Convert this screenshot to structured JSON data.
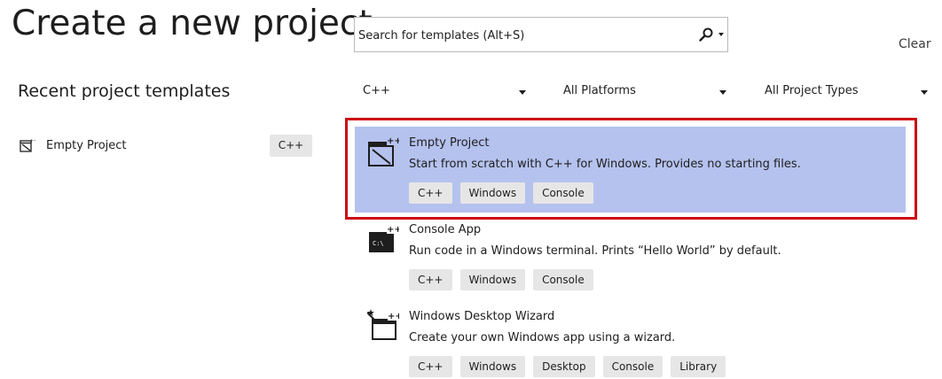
{
  "page": {
    "title": "Create a new project",
    "clear_label": "Clear"
  },
  "search": {
    "placeholder": "Search for templates (Alt+S)",
    "icon": "search-icon"
  },
  "recent": {
    "heading": "Recent project templates",
    "items": [
      {
        "label": "Empty Project",
        "tag": "C++",
        "icon": "empty-project-icon"
      }
    ]
  },
  "filters": {
    "language": "C++",
    "platform": "All Platforms",
    "project_type": "All Project Types"
  },
  "templates": [
    {
      "title": "Empty Project",
      "description": "Start from scratch with C++ for Windows. Provides no starting files.",
      "tags": [
        "C++",
        "Windows",
        "Console"
      ],
      "icon": "empty-project-icon",
      "selected": true
    },
    {
      "title": "Console App",
      "description": "Run code in a Windows terminal. Prints “Hello World” by default.",
      "tags": [
        "C++",
        "Windows",
        "Console"
      ],
      "icon": "console-app-icon",
      "selected": false
    },
    {
      "title": "Windows Desktop Wizard",
      "description": "Create your own Windows app using a wizard.",
      "tags": [
        "C++",
        "Windows",
        "Desktop",
        "Console",
        "Library"
      ],
      "icon": "desktop-wizard-icon",
      "selected": false
    }
  ],
  "colors": {
    "selected_background": "#b5c2ee",
    "highlight_border": "#cc0a14",
    "tag_background": "#e6e6e6"
  }
}
